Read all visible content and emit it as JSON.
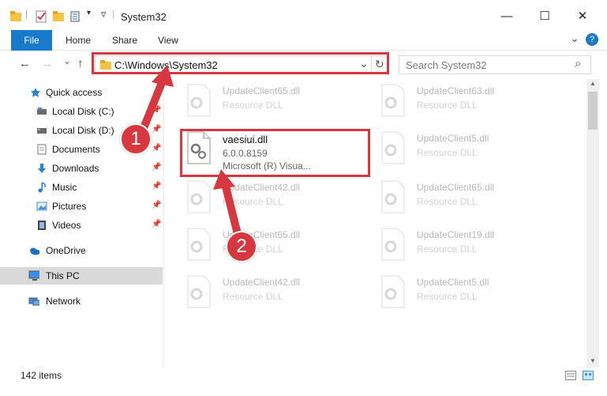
{
  "window": {
    "title": "System32",
    "minimize_glyph": "—",
    "maximize_glyph": "☐",
    "close_glyph": "✕"
  },
  "ribbon": {
    "tabs": [
      "File",
      "Home",
      "Share",
      "View"
    ],
    "collapse_glyph": "⌄",
    "help_glyph": "?"
  },
  "address": {
    "path": "C:\\Windows\\System32",
    "dropdown_glyph": "⌄",
    "refresh_glyph": "↻"
  },
  "search": {
    "placeholder": "Search System32",
    "icon_glyph": "⌕"
  },
  "nav_buttons": {
    "back": "←",
    "forward": "→",
    "recent": "⌄",
    "up": "↑"
  },
  "sidebar": {
    "items": [
      {
        "label": "Quick access",
        "icon": "star-icon",
        "pinned": false
      },
      {
        "label": "Local Disk (C:)",
        "icon": "drive-icon",
        "pinned": true
      },
      {
        "label": "Local Disk (D:)",
        "icon": "drive-icon",
        "pinned": true
      },
      {
        "label": "Documents",
        "icon": "documents-icon",
        "pinned": true
      },
      {
        "label": "Downloads",
        "icon": "downloads-icon",
        "pinned": true
      },
      {
        "label": "Music",
        "icon": "music-icon",
        "pinned": true
      },
      {
        "label": "Pictures",
        "icon": "pictures-icon",
        "pinned": true
      },
      {
        "label": "Videos",
        "icon": "videos-icon",
        "pinned": true
      },
      {
        "label": "OneDrive",
        "icon": "onedrive-icon",
        "pinned": false
      },
      {
        "label": "This PC",
        "icon": "computer-icon",
        "pinned": false
      },
      {
        "label": "Network",
        "icon": "network-icon",
        "pinned": false
      }
    ],
    "pin_glyph": "📌"
  },
  "files": [
    {
      "name": "UpdateClient65.dll",
      "type": "Resource DLL"
    },
    {
      "name": "UpdateClient63.dll",
      "type": "Resource DLL"
    },
    {
      "name": "vaesiui.dll",
      "version": "6.0.0.8159",
      "description": "Microsoft (R) Visua..."
    },
    {
      "name": "UpdateClient5.dll",
      "type": "Resource DLL"
    },
    {
      "name": "UpdateClient42.dll",
      "type": "Resource DLL"
    },
    {
      "name": "UpdateClient65.dll",
      "type": "Resource DLL"
    },
    {
      "name": "UpdateClient65.dll",
      "type": "Resource DLL"
    },
    {
      "name": "UpdateClient19.dll",
      "type": "Resource DLL"
    },
    {
      "name": "UpdateClient42.dll",
      "type": "Resource DLL"
    },
    {
      "name": "UpdateClient5.dll",
      "type": "Resource DLL"
    }
  ],
  "status": {
    "item_count": "142 items"
  },
  "annotations": {
    "step1": "1",
    "step2": "2",
    "color": "#d7373f"
  },
  "colors": {
    "accent": "#1979ca",
    "highlight": "#d7373f",
    "selected_nav": "#d9d9d9"
  }
}
